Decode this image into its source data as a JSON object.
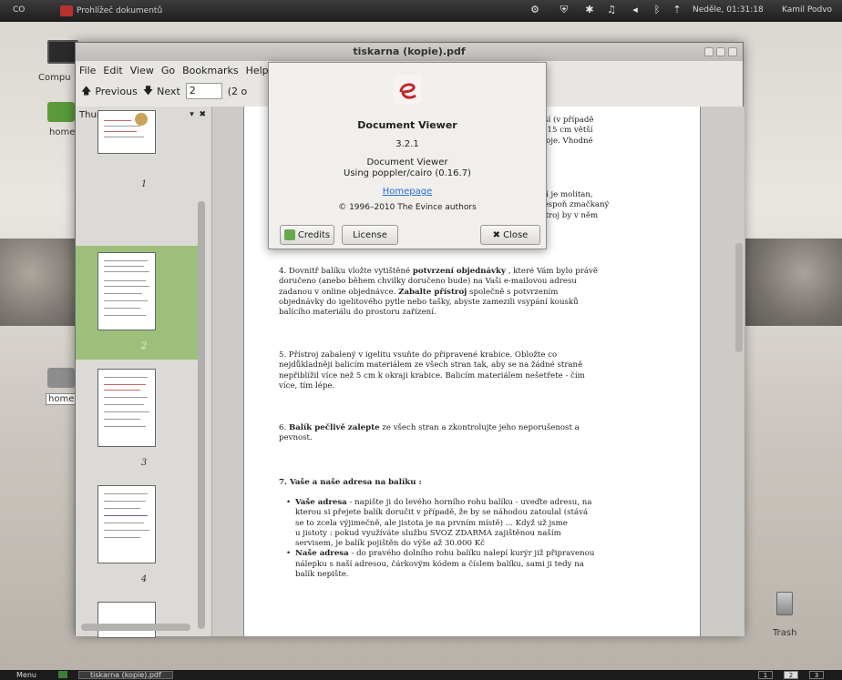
{
  "top_panel": {
    "left_label": "CO",
    "app_label": "Prohlížeč dokumentů",
    "clock": "Neděle, 01:31:18",
    "user": "Kamil Podvo"
  },
  "desktop": {
    "icons": [
      {
        "label": "Compu"
      },
      {
        "label": "home"
      },
      {
        "label": "home"
      },
      {
        "label": "Trash"
      }
    ]
  },
  "window": {
    "title": "tiskarna (kopie).pdf",
    "menu": [
      "File",
      "Edit",
      "View",
      "Go",
      "Bookmarks",
      "Help"
    ],
    "toolbar": {
      "previous_label": "Previous",
      "next_label": "Next",
      "page_value": "2",
      "page_of": "(2 o"
    },
    "sidebar": {
      "title": "Thumbnails",
      "pages": [
        "1",
        "2",
        "3",
        "4"
      ]
    }
  },
  "document": {
    "partial_lines_top": [
      "cm větší (v případě",
      "kg) a o 15 cm větší",
      "r přístroje. Vhodné"
    ],
    "partial_lines_mid": [
      "nejlepší je molitan,",
      "ouzi alespoň zmačkaný",
      "1 - přístroj by v něm"
    ],
    "p4_lead": "4. Dovnitř balíku vložte vytištěné",
    "p4_bold": "potvrzení objednávky",
    "p4_rest_line1": ", které Vám bylo právě",
    "p4_line2": "doručeno (anebo během chvilky doručeno bude) na Vaši e-mailovou adresu",
    "p4_line3_a": "zadanou v online objednávce.",
    "p4_line3_bold": "Zabalte přístroj",
    "p4_line3_b": "společně s potvrzením",
    "p4_line4": "objednávky do igelitového pytle nebo tašky, abyste zamezili vsypání kousků",
    "p4_line5": "balícího materiálu do prostoru zařízení.",
    "p5_lines": [
      "5. Přístroj zabalený v igelitu vsuňte do připravené krabice. Obložte co",
      "nejdůkladněji balicím materiálem ze všech stran tak, aby se na žádné straně",
      "nepřiblížil více než 5 cm k okraji krabice. Balicím materiálem nešetřete - čím",
      "více, tím lépe."
    ],
    "p6_lead": "6.",
    "p6_bold": "Balík pečlivě zalepte",
    "p6_rest": "ze všech stran a zkontrolujte jeho neporušenost a",
    "p6_line2": "pevnost.",
    "p7_head": "7. Vaše a naše adresa na balíku :",
    "b1_bold": "Vaše adresa",
    "b1_lines": [
      " - napište ji do levého horního rohu balíku - uveďte adresu, na",
      "kterou si přejete balík doručit v případě, že by se náhodou zatoulal (stává",
      "se to zcela výjimečně, ale jistota je na prvním místě) ... Když už jsme",
      "u jistoty : pokud využíváte službu SVOZ ZDARMA zajištěnou naším",
      "servisem, je balík pojištěn do výše až 30.000 Kč"
    ],
    "b2_bold": "Naše adresa",
    "b2_lines": [
      " - do pravého dolního rohu balíku nalepí kurýr již připravenou",
      "nálepku s naší adresou, čárkovým kódem a číslem balíku, sami ji tedy na",
      "balík nepište."
    ]
  },
  "about": {
    "app_name": "Document Viewer",
    "version": "3.2.1",
    "desc_line1": "Document Viewer",
    "desc_line2": "Using poppler/cairo (0.16.7)",
    "homepage": "Homepage",
    "copyright": "© 1996–2010 The Evince authors",
    "credits": "Credits",
    "license": "License",
    "close": "Close"
  },
  "bottom_panel": {
    "menu": "Menu",
    "task": "tiskarna (kopie).pdf",
    "workspaces": [
      "1",
      "2",
      "3"
    ]
  }
}
